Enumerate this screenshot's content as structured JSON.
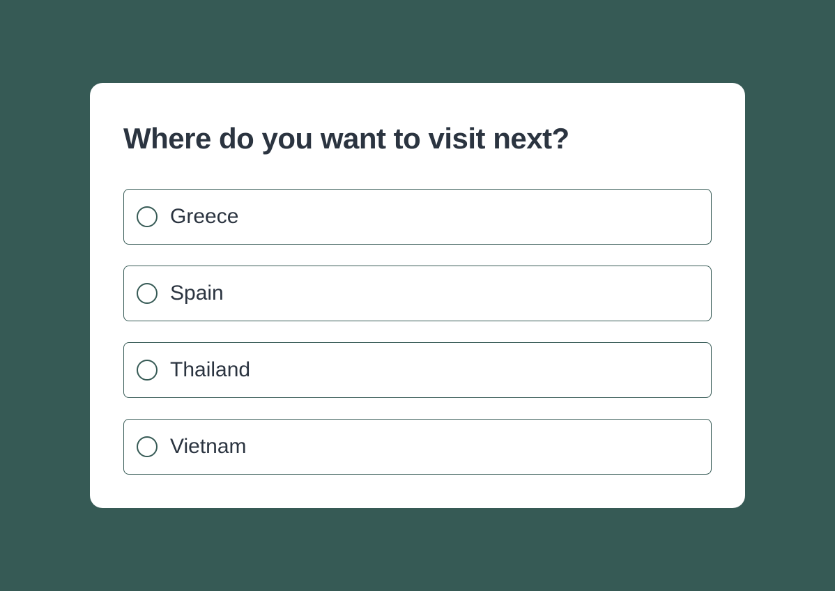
{
  "poll": {
    "question": "Where do you want to visit next?",
    "options": [
      {
        "label": "Greece"
      },
      {
        "label": "Spain"
      },
      {
        "label": "Thailand"
      },
      {
        "label": "Vietnam"
      }
    ]
  }
}
